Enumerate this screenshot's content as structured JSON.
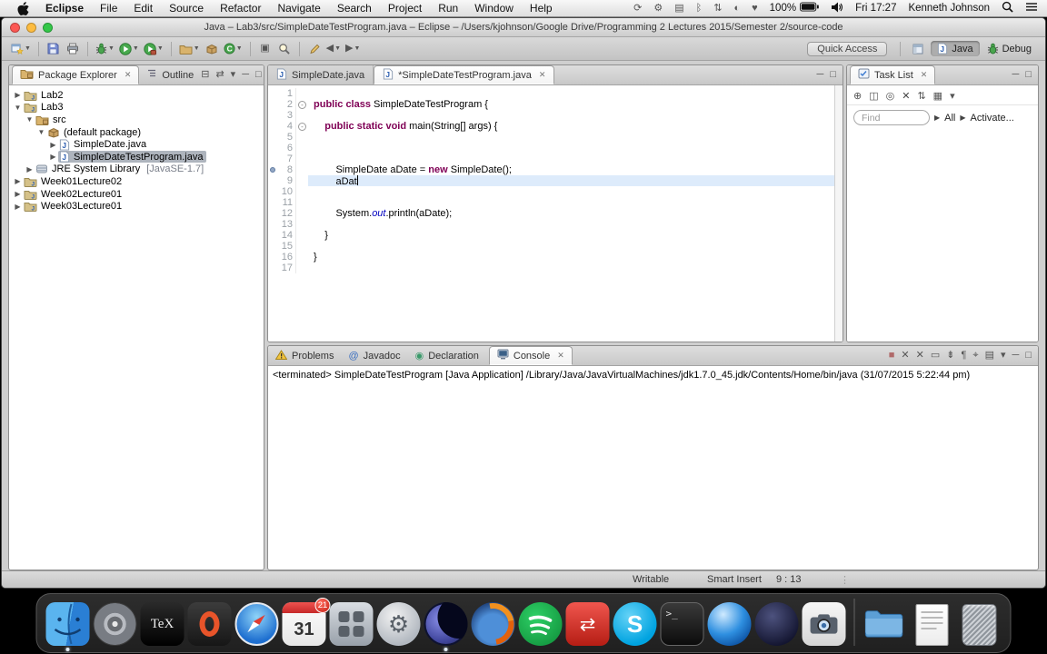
{
  "menubar": {
    "app_name": "Eclipse",
    "menus": [
      "File",
      "Edit",
      "Source",
      "Refactor",
      "Navigate",
      "Search",
      "Project",
      "Run",
      "Window",
      "Help"
    ],
    "status_icons": [
      "time-machine-icon",
      "gear-icon",
      "window-icon",
      "bluetooth-icon",
      "updown-icon",
      "contrast-icon",
      "heart-icon"
    ],
    "battery_label": "100%",
    "clock": "Fri 17:27",
    "user": "Kenneth Johnson"
  },
  "window": {
    "title": "Java – Lab3/src/SimpleDateTestProgram.java – Eclipse – /Users/kjohnson/Google Drive/Programming 2 Lectures 2015/Semester 2/source-code"
  },
  "toolbar": {
    "quick_access": "Quick Access",
    "buttons": [
      {
        "icon": "new-wizard-icon",
        "dd": true
      },
      {
        "sep": true
      },
      {
        "icon": "save-icon"
      },
      {
        "icon": "print-icon"
      },
      {
        "sep": true
      },
      {
        "icon": "debug-icon",
        "dd": true
      },
      {
        "icon": "run-icon",
        "dd": true
      },
      {
        "icon": "external-tools-icon",
        "dd": true
      },
      {
        "sep": true
      },
      {
        "icon": "new-java-project-icon",
        "dd": true
      },
      {
        "icon": "new-package-icon"
      },
      {
        "icon": "new-class-icon",
        "dd": true
      },
      {
        "sep": true
      },
      {
        "icon": "task-icon"
      },
      {
        "icon": "search-icon"
      },
      {
        "sep": true
      },
      {
        "icon": "last-edit-icon"
      },
      {
        "icon": "back-icon",
        "dd": true
      },
      {
        "icon": "forward-icon",
        "dd": true
      }
    ],
    "perspectives": [
      {
        "icon": "grid-icon",
        "label": "",
        "active": false
      },
      {
        "icon": "java-icon",
        "label": "Java",
        "active": true
      },
      {
        "icon": "bug-icon",
        "label": "Debug",
        "active": false
      }
    ]
  },
  "package_explorer": {
    "tab": "Package Explorer",
    "outline_tab": "Outline",
    "header_icons": [
      "collapse-all-icon",
      "link-editor-icon",
      "view-menu-icon",
      "minimize-icon",
      "maximize-icon"
    ],
    "tree": [
      {
        "label": "Lab2",
        "level": 0,
        "icon": "project-icon",
        "arrow": "col"
      },
      {
        "label": "Lab3",
        "level": 0,
        "icon": "project-icon",
        "arrow": "exp"
      },
      {
        "label": "src",
        "level": 1,
        "icon": "src-folder-icon",
        "arrow": "exp"
      },
      {
        "label": "(default package)",
        "level": 2,
        "icon": "package-icon",
        "arrow": "exp"
      },
      {
        "label": "SimpleDate.java",
        "level": 3,
        "icon": "java-file-icon",
        "arrow": "col"
      },
      {
        "label": "SimpleDateTestProgram.java",
        "level": 3,
        "icon": "java-file-icon",
        "arrow": "col",
        "selected": true
      },
      {
        "label": "JRE System Library",
        "detail": "[JavaSE-1.7]",
        "level": 1,
        "icon": "jre-icon",
        "arrow": "col"
      },
      {
        "label": "Week01Lecture02",
        "level": 0,
        "icon": "project-icon",
        "arrow": "col"
      },
      {
        "label": "Week02Lecture01",
        "level": 0,
        "icon": "project-icon",
        "arrow": "col"
      },
      {
        "label": "Week03Lecture01",
        "level": 0,
        "icon": "project-icon",
        "arrow": "col"
      }
    ]
  },
  "editor": {
    "header_icons": [
      "minimize-icon",
      "maximize-icon"
    ],
    "tabs": [
      {
        "label": "SimpleDate.java",
        "active": false
      },
      {
        "label": "*SimpleDateTestProgram.java",
        "active": true
      }
    ],
    "lines": [
      {
        "n": "1"
      },
      {
        "n": "2",
        "fold": true,
        "segs": [
          {
            "c": "k",
            "t": "public class "
          },
          {
            "c": "p",
            "t": "SimpleDateTestProgram {"
          }
        ]
      },
      {
        "n": "3"
      },
      {
        "n": "4",
        "fold": true,
        "segs": [
          {
            "c": "p",
            "t": "    "
          },
          {
            "c": "k",
            "t": "public static void "
          },
          {
            "c": "p",
            "t": "main(String[] args) {"
          }
        ]
      },
      {
        "n": "5"
      },
      {
        "n": "6"
      },
      {
        "n": "7"
      },
      {
        "n": "8",
        "dot": true,
        "segs": [
          {
            "c": "p",
            "t": "        SimpleDate aDate = "
          },
          {
            "c": "k",
            "t": "new"
          },
          {
            "c": "p",
            "t": " SimpleDate();"
          }
        ]
      },
      {
        "n": "9",
        "current": true,
        "cursor": true,
        "segs": [
          {
            "c": "p",
            "t": "        aDat"
          }
        ]
      },
      {
        "n": "10"
      },
      {
        "n": "11"
      },
      {
        "n": "12",
        "segs": [
          {
            "c": "p",
            "t": "        System."
          },
          {
            "c": "f",
            "t": "out"
          },
          {
            "c": "p",
            "t": ".println(aDate);"
          }
        ]
      },
      {
        "n": "13"
      },
      {
        "n": "14",
        "segs": [
          {
            "c": "p",
            "t": "    }"
          }
        ]
      },
      {
        "n": "15"
      },
      {
        "n": "16",
        "segs": [
          {
            "c": "p",
            "t": "}"
          }
        ]
      },
      {
        "n": "17"
      }
    ]
  },
  "task_list": {
    "tab": "Task List",
    "header_icons": [
      "minimize-icon",
      "maximize-icon"
    ],
    "toolbar_icons": [
      "new-task-icon",
      "categorize-icon",
      "focus-icon",
      "delete-icon",
      "sort-icon",
      "schedule-icon",
      "view-menu-icon"
    ],
    "find_placeholder": "Find",
    "all_label": "All",
    "activate_label": "Activate..."
  },
  "console": {
    "tabs": [
      {
        "label": "Problems",
        "icon": "problems-icon",
        "active": false
      },
      {
        "label": "Javadoc",
        "icon": "javadoc-icon",
        "active": false
      },
      {
        "label": "Declaration",
        "icon": "declaration-icon",
        "active": false
      },
      {
        "label": "Console",
        "icon": "console-icon",
        "active": true
      }
    ],
    "toolbar_icons": [
      "terminate-icon",
      "remove-launch-icon",
      "remove-all-icon",
      "clear-console-icon",
      "scroll-lock-icon",
      "word-wrap-icon",
      "pin-console-icon",
      "open-console-icon",
      "view-menu-icon",
      "minimize-icon",
      "maximize-icon"
    ],
    "text": "<terminated> SimpleDateTestProgram [Java Application] /Library/Java/JavaVirtualMachines/jdk1.7.0_45.jdk/Contents/Home/bin/java (31/07/2015 5:22:44 pm)"
  },
  "statusbar": {
    "writable": "Writable",
    "insert_mode": "Smart Insert",
    "position": "9 : 13"
  },
  "dock": {
    "items": [
      {
        "name": "finder",
        "running": true
      },
      {
        "name": "dvd-player"
      },
      {
        "name": "texshop",
        "text": "TeX"
      },
      {
        "name": "opera"
      },
      {
        "name": "safari"
      },
      {
        "name": "calendar",
        "day": "31",
        "badge": "21"
      },
      {
        "name": "utility-grid"
      },
      {
        "name": "system-preferences"
      },
      {
        "name": "eclipse",
        "running": true
      },
      {
        "name": "firefox"
      },
      {
        "name": "spotify"
      },
      {
        "name": "red-transfer"
      },
      {
        "name": "skype",
        "letter": "S"
      },
      {
        "name": "terminal",
        "text": ">_"
      },
      {
        "name": "blue-globe"
      },
      {
        "name": "dark-sphere"
      },
      {
        "name": "photo-booth"
      },
      {
        "divider": true
      },
      {
        "name": "downloads-folder"
      },
      {
        "name": "document"
      },
      {
        "name": "trash"
      }
    ]
  }
}
